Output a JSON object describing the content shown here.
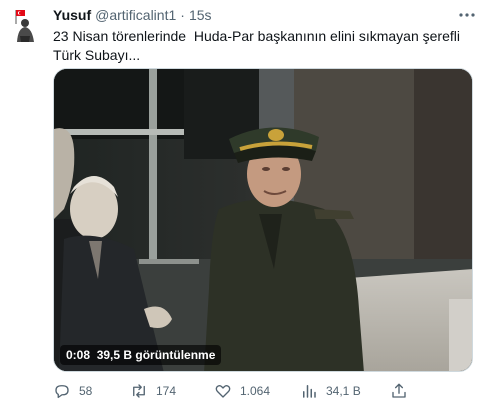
{
  "tweet": {
    "author_name": "Yusuf",
    "author_handle": "@artificalint1",
    "separator": "·",
    "time": "15s",
    "text": "23 Nisan törenlerinde  Huda-Par başkanının elini sıkmayan şerefli  Türk Subayı..."
  },
  "video": {
    "duration": "0:08",
    "views": "39,5 B görüntülenme"
  },
  "actions": {
    "reply_count": "58",
    "retweet_count": "174",
    "like_count": "1.064",
    "view_count": "34,1 B"
  },
  "icons": {
    "avatar": "flag-figure-avatar",
    "more": "more-icon",
    "reply": "reply-icon",
    "retweet": "retweet-icon",
    "like": "heart-icon",
    "views": "views-icon",
    "share": "share-icon"
  },
  "colors": {
    "text": "#0f1419",
    "secondary": "#536471",
    "flag_red": "#e30a17"
  }
}
